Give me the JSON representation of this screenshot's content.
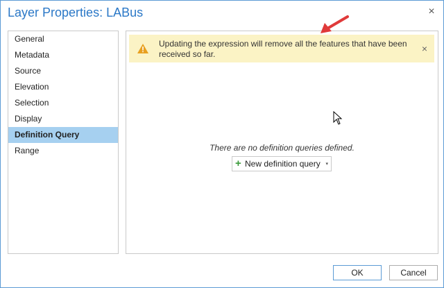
{
  "window": {
    "title": "Layer Properties: LABus",
    "close_glyph": "×"
  },
  "sidebar": {
    "items": [
      {
        "label": "General"
      },
      {
        "label": "Metadata"
      },
      {
        "label": "Source"
      },
      {
        "label": "Elevation"
      },
      {
        "label": "Selection"
      },
      {
        "label": "Display"
      },
      {
        "label": "Definition Query",
        "selected": true
      },
      {
        "label": "Range"
      }
    ]
  },
  "banner": {
    "icon": "warning-icon",
    "text": "Updating the expression will remove all the features that have been received so far.",
    "close_glyph": "×",
    "background": "#fbf3c5",
    "icon_color": "#e8a020"
  },
  "main": {
    "empty_message": "There are no definition queries defined.",
    "new_query_button": {
      "label": "New definition query",
      "icon": "plus-icon",
      "dropdown_icon": "▾"
    }
  },
  "annotation": {
    "icon": "red-arrow-icon",
    "color": "#e03a3a"
  },
  "footer": {
    "ok_label": "OK",
    "cancel_label": "Cancel"
  },
  "colors": {
    "accent": "#2b78c7",
    "selection": "#a6d0f0",
    "border": "#5b9bd5"
  }
}
